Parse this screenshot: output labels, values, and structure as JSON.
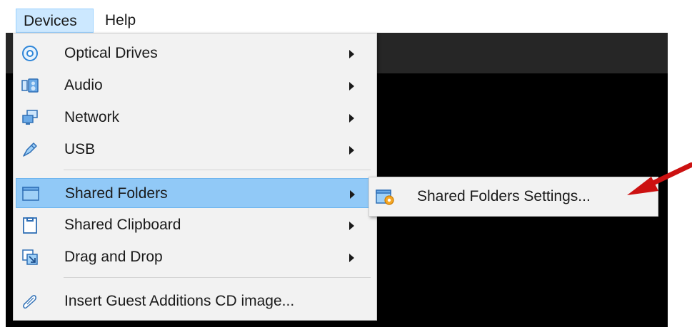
{
  "menubar": {
    "devices": "Devices",
    "help": "Help"
  },
  "devices_menu": {
    "items": [
      {
        "label": "Optical Drives",
        "icon": "optical-disc-icon"
      },
      {
        "label": "Audio",
        "icon": "speaker-icon"
      },
      {
        "label": "Network",
        "icon": "network-icon"
      },
      {
        "label": "USB",
        "icon": "usb-icon"
      },
      {
        "label": "Shared Folders",
        "icon": "folder-icon",
        "highlighted": true
      },
      {
        "label": "Shared Clipboard",
        "icon": "clipboard-icon"
      },
      {
        "label": "Drag and Drop",
        "icon": "drag-drop-icon"
      },
      {
        "label": "Insert Guest Additions CD image...",
        "icon": "cd-image-icon"
      }
    ]
  },
  "shared_folders_submenu": {
    "items": [
      {
        "label": "Shared Folders Settings...",
        "icon": "folder-settings-icon"
      }
    ]
  },
  "annotation": {
    "arrow_color": "#cc1111"
  },
  "colors": {
    "highlight": "#91c9f7",
    "menubar_active": "#cce8ff",
    "vm_screen": "#000000"
  }
}
